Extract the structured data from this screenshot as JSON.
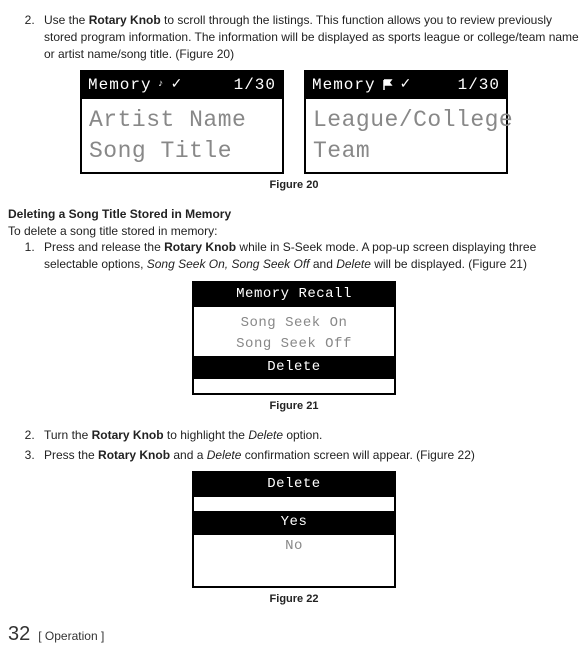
{
  "instr2": {
    "prefix": "Use the ",
    "knob": "Rotary Knob",
    "rest": " to scroll through the listings. This function allows you to review previously stored program information. The information will be displayed as sports league or college/team name or artist name/song title. (Figure 20)"
  },
  "fig20": {
    "left": {
      "memory": "Memory",
      "count": "1/30",
      "line1": "Artist Name",
      "line2": "Song Title"
    },
    "right": {
      "memory": "Memory",
      "count": "1/30",
      "line1": "League/College",
      "line2": "Team"
    },
    "caption": "Figure 20"
  },
  "section_heading": "Deleting a Song Title Stored in Memory",
  "section_intro": "To delete a song title stored in memory:",
  "step1": {
    "a": "Press and release the ",
    "knob": "Rotary Knob",
    "b": " while in S-Seek mode.  A pop-up screen displaying three selectable options, ",
    "opt1": "Song Seek On, Song Seek Off",
    "c": " and ",
    "opt2": "Delete",
    "d": " will be displayed. (Figure 21)"
  },
  "fig21": {
    "title": "Memory Recall",
    "item1": "Song Seek On",
    "item2": "Song Seek Off",
    "item3": "Delete",
    "caption": "Figure 21"
  },
  "step2": {
    "a": "Turn the ",
    "knob": "Rotary Knob",
    "b": " to highlight the ",
    "del": "Delete",
    "c": " option."
  },
  "step3": {
    "a": "Press the ",
    "knob": "Rotary Knob",
    "b": " and a ",
    "del": "Delete",
    "c": " confirmation screen will appear. (Figure 22)"
  },
  "fig22": {
    "title": "Delete",
    "yes": "Yes",
    "no": "No",
    "caption": "Figure 22"
  },
  "footer": {
    "page": "32",
    "section": "[ Operation ]"
  },
  "icons": {
    "check": "✓"
  }
}
